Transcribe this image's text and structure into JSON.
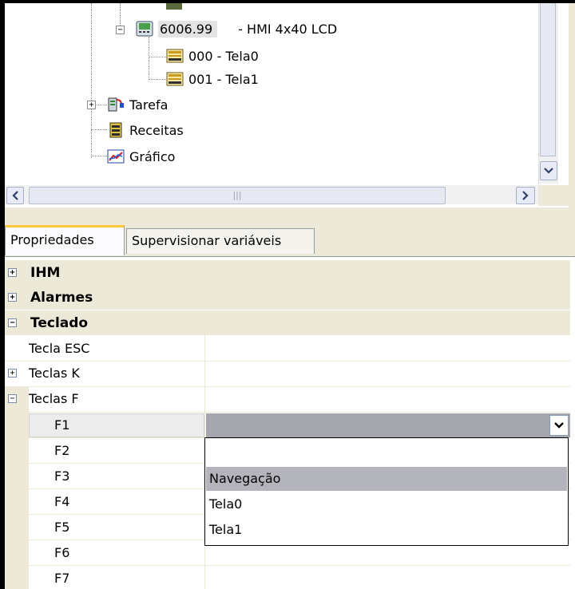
{
  "tree": {
    "device": {
      "code": "6006.99",
      "desc": "- HMI 4x40 LCD",
      "icon": "hmi-device-icon"
    },
    "screens": [
      {
        "label": "000 - Tela0",
        "icon": "screen-icon"
      },
      {
        "label": "001 - Tela1",
        "icon": "screen-icon"
      }
    ],
    "nodes": [
      {
        "label": "Tarefa",
        "icon": "task-icon"
      },
      {
        "label": "Receitas",
        "icon": "recipes-icon"
      },
      {
        "label": "Gráfico",
        "icon": "chart-icon"
      }
    ]
  },
  "tabs": {
    "properties": "Propriedades",
    "watch": "Supervisionar variáveis"
  },
  "grid": {
    "categories": [
      "IHM",
      "Alarmes",
      "Teclado"
    ],
    "keyboard_items": [
      "Tecla ESC",
      "Teclas K",
      "Teclas F"
    ],
    "f_keys": [
      "F1",
      "F2",
      "F3",
      "F4",
      "F5",
      "F6",
      "F7"
    ]
  },
  "dropdown": {
    "options": [
      "",
      "Navegação",
      "Tela0",
      "Tela1"
    ],
    "selected": "Navegação"
  },
  "colors": {
    "tab_accent": "#ffc83c",
    "category_bg": "#ece9d8",
    "selection": "#b4b4bc"
  }
}
